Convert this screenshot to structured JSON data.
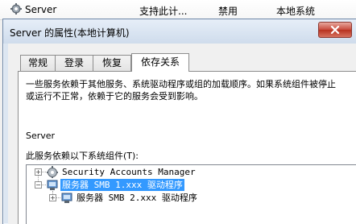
{
  "service_row": {
    "name": "Server",
    "description": "支持此计...",
    "startup_type": "禁用",
    "logon_as": "本地系统"
  },
  "dialog": {
    "title": "Server 的属性(本地计算机)",
    "tabs": [
      {
        "label": "常规"
      },
      {
        "label": "登录"
      },
      {
        "label": "恢复"
      },
      {
        "label": "依存关系"
      }
    ],
    "description": "一些服务依赖于其他服务、系统驱动程序或组的加载顺序。如果系统组件被停止或运行不正常，依赖于它的服务会受到影响。",
    "service_name": "Server",
    "depends_label": "此服务依赖以下系统组件(T):",
    "tree": [
      {
        "label": "Security Accounts Manager",
        "expander": "+"
      },
      {
        "label": "服务器 SMB 1.xxx 驱动程序",
        "expander": "−"
      },
      {
        "label": "服务器 SMB 2.xxx 驱动程序",
        "expander": "+"
      }
    ]
  }
}
